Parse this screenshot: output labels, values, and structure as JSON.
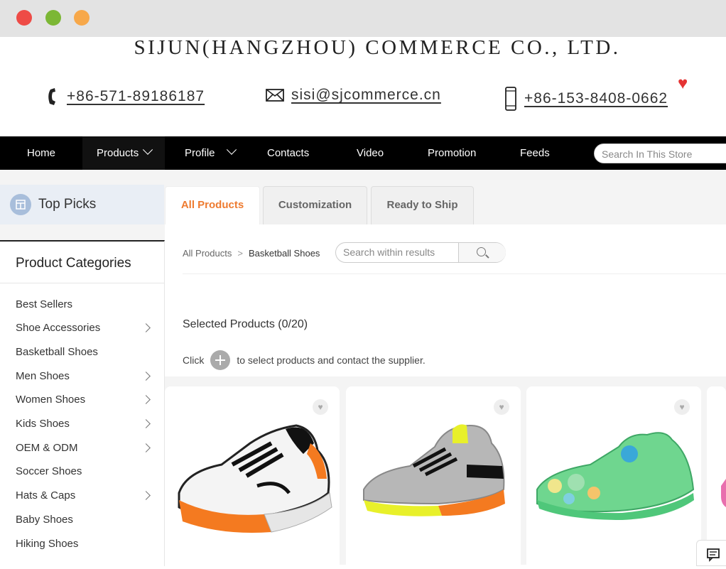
{
  "window": {
    "controls": [
      "close",
      "minimize",
      "maximize"
    ]
  },
  "header": {
    "company": "SIJUN(HANGZHOU) COMMERCE CO., LTD.",
    "phone": "+86-571-89186187",
    "email": "sisi@sjcommerce.cn",
    "mobile": "+86-153-8408-0662"
  },
  "nav": {
    "items": [
      "Home",
      "Products",
      "Profile",
      "Contacts",
      "Video",
      "Promotion",
      "Feeds"
    ],
    "search_placeholder": "Search In This Store"
  },
  "top_picks": {
    "label": "Top Picks"
  },
  "tabs": [
    "All Products",
    "Customization",
    "Ready to Ship"
  ],
  "categories": {
    "title": "Product Categories",
    "items": [
      "Best Sellers",
      "Shoe Accessories",
      "Basketball Shoes",
      "Men Shoes",
      "Women Shoes",
      "Kids Shoes",
      "OEM & ODM",
      "Soccer Shoes",
      "Hats & Caps",
      "Baby Shoes",
      "Hiking Shoes"
    ]
  },
  "breadcrumb": {
    "root": "All Products",
    "current": "Basketball Shoes"
  },
  "result_search": {
    "placeholder": "Search within results"
  },
  "selection": {
    "label": "Selected Products (0/20)",
    "hint_before": "Click",
    "hint_after": "to select products and contact the supplier."
  },
  "products": [
    {
      "name": "white-orange-basketball-shoe",
      "accent": "#f47a20"
    },
    {
      "name": "grey-yellow-basketball-shoe",
      "accent": "#e8f02a"
    },
    {
      "name": "green-basketball-shoe",
      "accent": "#6fd68f"
    }
  ],
  "colors": {
    "accent": "#ee7b30",
    "nav_bg": "#000000",
    "heart": "#e53333"
  }
}
